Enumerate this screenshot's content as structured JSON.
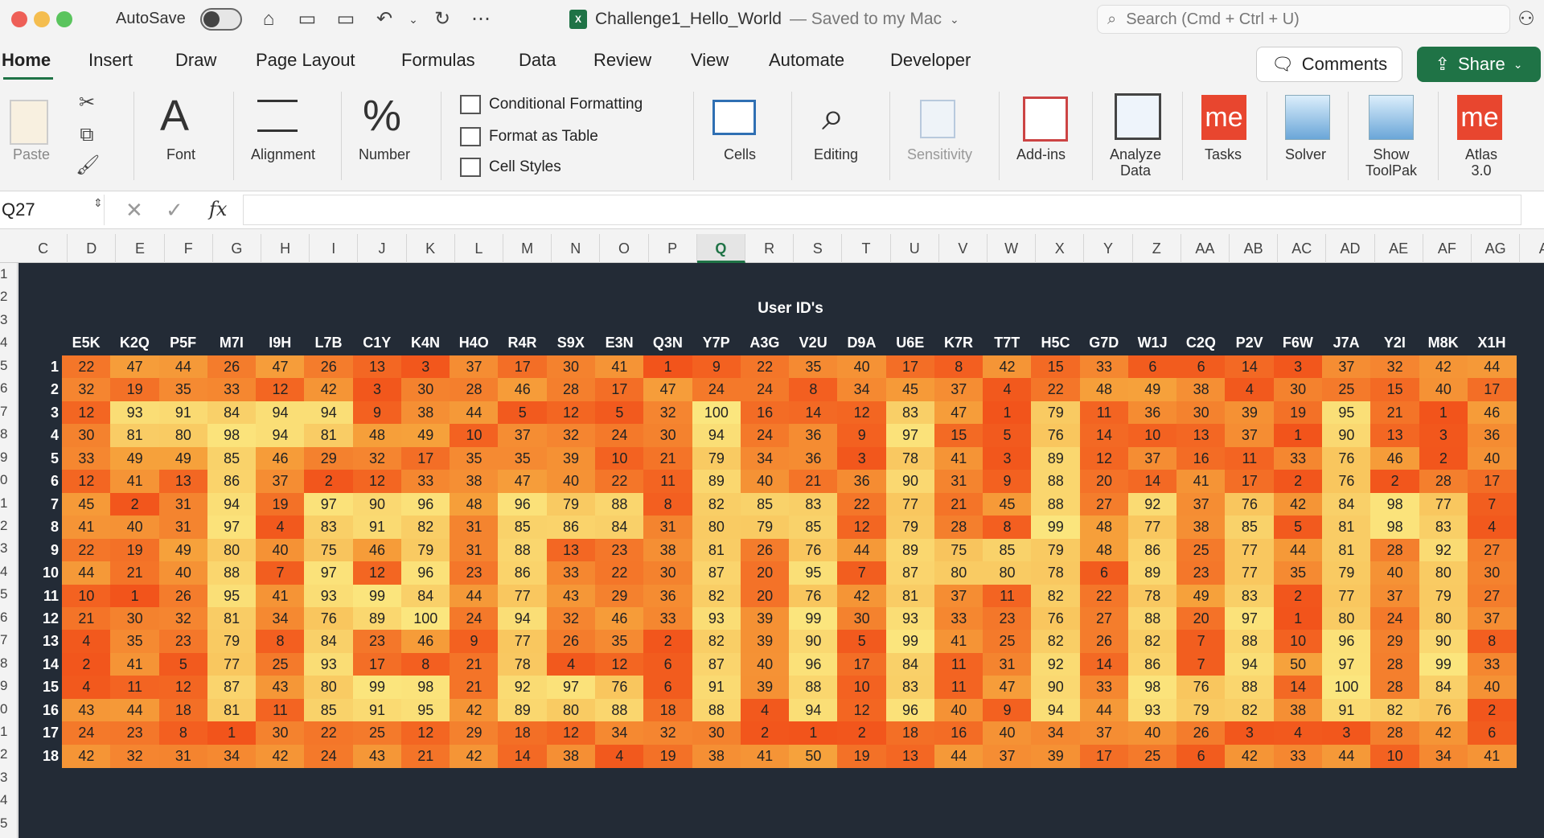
{
  "titlebar": {
    "autosave_label": "AutoSave",
    "doc_name": "Challenge1_Hello_World",
    "doc_status": "— Saved to my Mac",
    "search_placeholder": "Search (Cmd + Ctrl + U)",
    "file_badge": "X"
  },
  "tabs": [
    "Home",
    "Insert",
    "Draw",
    "Page Layout",
    "Formulas",
    "Data",
    "Review",
    "View",
    "Automate",
    "Developer"
  ],
  "active_tab": "Home",
  "buttons": {
    "comments": "Comments",
    "share": "Share"
  },
  "ribbon": {
    "paste": "Paste",
    "font": "Font",
    "alignment": "Alignment",
    "number": "Number",
    "conditional_formatting": "Conditional Formatting",
    "format_as_table": "Format as Table",
    "cell_styles": "Cell Styles",
    "cells": "Cells",
    "editing": "Editing",
    "sensitivity": "Sensitivity",
    "addins": "Add-ins",
    "analyze_data_1": "Analyze",
    "analyze_data_2": "Data",
    "tasks": "Tasks",
    "solver": "Solver",
    "show_toolpak_1": "Show",
    "show_toolpak_2": "ToolPak",
    "atlas_1": "Atlas",
    "atlas_2": "3.0",
    "me_text": "me",
    "font_glyph": "A",
    "number_glyph": "%"
  },
  "formula_bar": {
    "name_box": "Q27",
    "fx": "fx",
    "value": ""
  },
  "column_letters": [
    "C",
    "D",
    "E",
    "F",
    "G",
    "H",
    "I",
    "J",
    "K",
    "L",
    "M",
    "N",
    "O",
    "P",
    "Q",
    "R",
    "S",
    "T",
    "U",
    "V",
    "W",
    "X",
    "Y",
    "Z",
    "AA",
    "AB",
    "AC",
    "AD",
    "AE",
    "AF",
    "AG",
    "A"
  ],
  "active_column": "Q",
  "row_numbers": [
    "1",
    "2",
    "3",
    "4",
    "5",
    "6",
    "7",
    "8",
    "9",
    "0",
    "1",
    "2",
    "3",
    "4",
    "5",
    "6",
    "7",
    "8",
    "9",
    "0",
    "1",
    "2",
    "3",
    "4",
    "5"
  ],
  "chart_data": {
    "type": "heatmap",
    "title": "User ID's",
    "x": [
      "E5K",
      "K2Q",
      "P5F",
      "M7I",
      "I9H",
      "L7B",
      "C1Y",
      "K4N",
      "H4O",
      "R4R",
      "S9X",
      "E3N",
      "Q3N",
      "Y7P",
      "A3G",
      "V2U",
      "D9A",
      "U6E",
      "K7R",
      "T7T",
      "H5C",
      "G7D",
      "W1J",
      "C2Q",
      "P2V",
      "F6W",
      "J7A",
      "Y2I",
      "M8K",
      "X1H"
    ],
    "y": [
      "1",
      "2",
      "3",
      "4",
      "5",
      "6",
      "7",
      "8",
      "9",
      "10",
      "11",
      "12",
      "13",
      "14",
      "15",
      "16",
      "17",
      "18"
    ],
    "values": [
      [
        22,
        47,
        44,
        26,
        47,
        26,
        13,
        3,
        37,
        17,
        30,
        41,
        1,
        9,
        22,
        35,
        40,
        17,
        8,
        42,
        15,
        33,
        6,
        6,
        14,
        3,
        37,
        32,
        42,
        44
      ],
      [
        32,
        19,
        35,
        33,
        12,
        42,
        3,
        30,
        28,
        46,
        28,
        17,
        47,
        24,
        24,
        8,
        34,
        45,
        37,
        4,
        22,
        48,
        49,
        38,
        4,
        30,
        25,
        15,
        40,
        17
      ],
      [
        12,
        93,
        91,
        84,
        94,
        94,
        9,
        38,
        44,
        5,
        12,
        5,
        32,
        100,
        16,
        14,
        12,
        83,
        47,
        1,
        79,
        11,
        36,
        30,
        39,
        19,
        95,
        21,
        1,
        46
      ],
      [
        30,
        81,
        80,
        98,
        94,
        81,
        48,
        49,
        10,
        37,
        32,
        24,
        30,
        94,
        24,
        36,
        9,
        97,
        15,
        5,
        76,
        14,
        10,
        13,
        37,
        1,
        90,
        13,
        3,
        36
      ],
      [
        33,
        49,
        49,
        85,
        46,
        29,
        32,
        17,
        35,
        35,
        39,
        10,
        21,
        79,
        34,
        36,
        3,
        78,
        41,
        3,
        89,
        12,
        37,
        16,
        11,
        33,
        76,
        46,
        2,
        40
      ],
      [
        12,
        41,
        13,
        86,
        37,
        2,
        12,
        33,
        38,
        47,
        40,
        22,
        11,
        89,
        40,
        21,
        36,
        90,
        31,
        9,
        88,
        20,
        14,
        41,
        17,
        2,
        76,
        2,
        28,
        17
      ],
      [
        45,
        2,
        31,
        94,
        19,
        97,
        90,
        96,
        48,
        96,
        79,
        88,
        8,
        82,
        85,
        83,
        22,
        77,
        21,
        45,
        88,
        27,
        92,
        37,
        76,
        42,
        84,
        98,
        77,
        7
      ],
      [
        41,
        40,
        31,
        97,
        4,
        83,
        91,
        82,
        31,
        85,
        86,
        84,
        31,
        80,
        79,
        85,
        12,
        79,
        28,
        8,
        99,
        48,
        77,
        38,
        85,
        5,
        81,
        98,
        83,
        4
      ],
      [
        22,
        19,
        49,
        80,
        40,
        75,
        46,
        79,
        31,
        88,
        13,
        23,
        38,
        81,
        26,
        76,
        44,
        89,
        75,
        85,
        79,
        48,
        86,
        25,
        77,
        44,
        81,
        28,
        92,
        27
      ],
      [
        44,
        21,
        40,
        88,
        7,
        97,
        12,
        96,
        23,
        86,
        33,
        22,
        30,
        87,
        20,
        95,
        7,
        87,
        80,
        80,
        78,
        6,
        89,
        23,
        77,
        35,
        79,
        40,
        80,
        30
      ],
      [
        10,
        1,
        26,
        95,
        41,
        93,
        99,
        84,
        44,
        77,
        43,
        29,
        36,
        82,
        20,
        76,
        42,
        81,
        37,
        11,
        82,
        22,
        78,
        49,
        83,
        2,
        77,
        37,
        79,
        27
      ],
      [
        21,
        30,
        32,
        81,
        34,
        76,
        89,
        100,
        24,
        94,
        32,
        46,
        33,
        93,
        39,
        99,
        30,
        93,
        33,
        23,
        76,
        27,
        88,
        20,
        97,
        1,
        80,
        24,
        80,
        37
      ],
      [
        4,
        35,
        23,
        79,
        8,
        84,
        23,
        46,
        9,
        77,
        26,
        35,
        2,
        82,
        39,
        90,
        5,
        99,
        41,
        25,
        82,
        26,
        82,
        7,
        88,
        10,
        96,
        29,
        90,
        8
      ],
      [
        2,
        41,
        5,
        77,
        25,
        93,
        17,
        8,
        21,
        78,
        4,
        12,
        6,
        87,
        40,
        96,
        17,
        84,
        11,
        31,
        92,
        14,
        86,
        7,
        94,
        50,
        97,
        28,
        99,
        33
      ],
      [
        4,
        11,
        12,
        87,
        43,
        80,
        99,
        98,
        21,
        92,
        97,
        76,
        6,
        91,
        39,
        88,
        10,
        83,
        11,
        47,
        90,
        33,
        98,
        76,
        88,
        14,
        100,
        28,
        84,
        40
      ],
      [
        43,
        44,
        18,
        81,
        11,
        85,
        91,
        95,
        42,
        89,
        80,
        88,
        18,
        88,
        4,
        94,
        12,
        96,
        40,
        9,
        94,
        44,
        93,
        79,
        82,
        38,
        91,
        82,
        76,
        2
      ],
      [
        24,
        23,
        8,
        1,
        30,
        22,
        25,
        12,
        29,
        18,
        12,
        34,
        32,
        30,
        2,
        1,
        2,
        18,
        16,
        40,
        34,
        37,
        40,
        26,
        3,
        4,
        3,
        28,
        42,
        6
      ],
      [
        42,
        32,
        31,
        34,
        42,
        24,
        43,
        21,
        42,
        14,
        38,
        4,
        19,
        38,
        41,
        50,
        19,
        13,
        44,
        37,
        39,
        17,
        25,
        6,
        42,
        33,
        44,
        10,
        34,
        41
      ]
    ],
    "color_low": "#f2541b",
    "color_mid": "#f6a33c",
    "color_high": "#fbe67e",
    "background": "#232b36",
    "label_color": "#ffffff"
  }
}
